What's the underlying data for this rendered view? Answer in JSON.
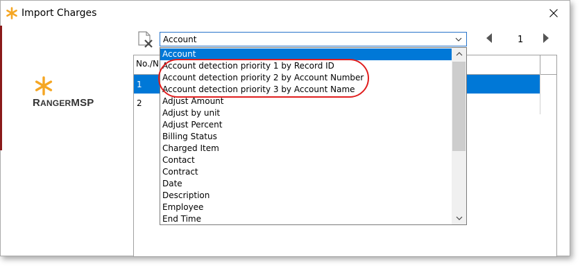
{
  "window": {
    "title": "Import Charges"
  },
  "logo": {
    "brand_first": "R",
    "brand_rest": "ANGER",
    "brand_suffix": "MSP"
  },
  "combo": {
    "value": "Account"
  },
  "pager": {
    "page": "1"
  },
  "grid": {
    "header": "No./N",
    "rows": [
      {
        "num": "1",
        "selected": true
      },
      {
        "num": "2",
        "selected": false
      }
    ]
  },
  "dropdown": {
    "items": [
      "Account",
      "Account detection priority 1 by Record ID",
      "Account detection priority 2 by Account Number",
      "Account detection priority 3 by Account Name",
      "Adjust Amount",
      "Adjust by unit",
      "Adjust Percent",
      "Billing Status",
      "Charged Item",
      "Contact",
      "Contract",
      "Date",
      "Description",
      "Employee",
      "End Time"
    ],
    "selected_index": 0
  },
  "colors": {
    "selection": "#0078d7",
    "annotation": "#e01e1e",
    "logo_orange": "#f5a623"
  },
  "icons": {
    "app": "asterisk-logo-icon",
    "close": "close-icon",
    "clear_file": "clear-file-icon",
    "prev": "prev-page-icon",
    "next": "next-page-icon",
    "combo_arrow": "chevron-down-icon"
  }
}
